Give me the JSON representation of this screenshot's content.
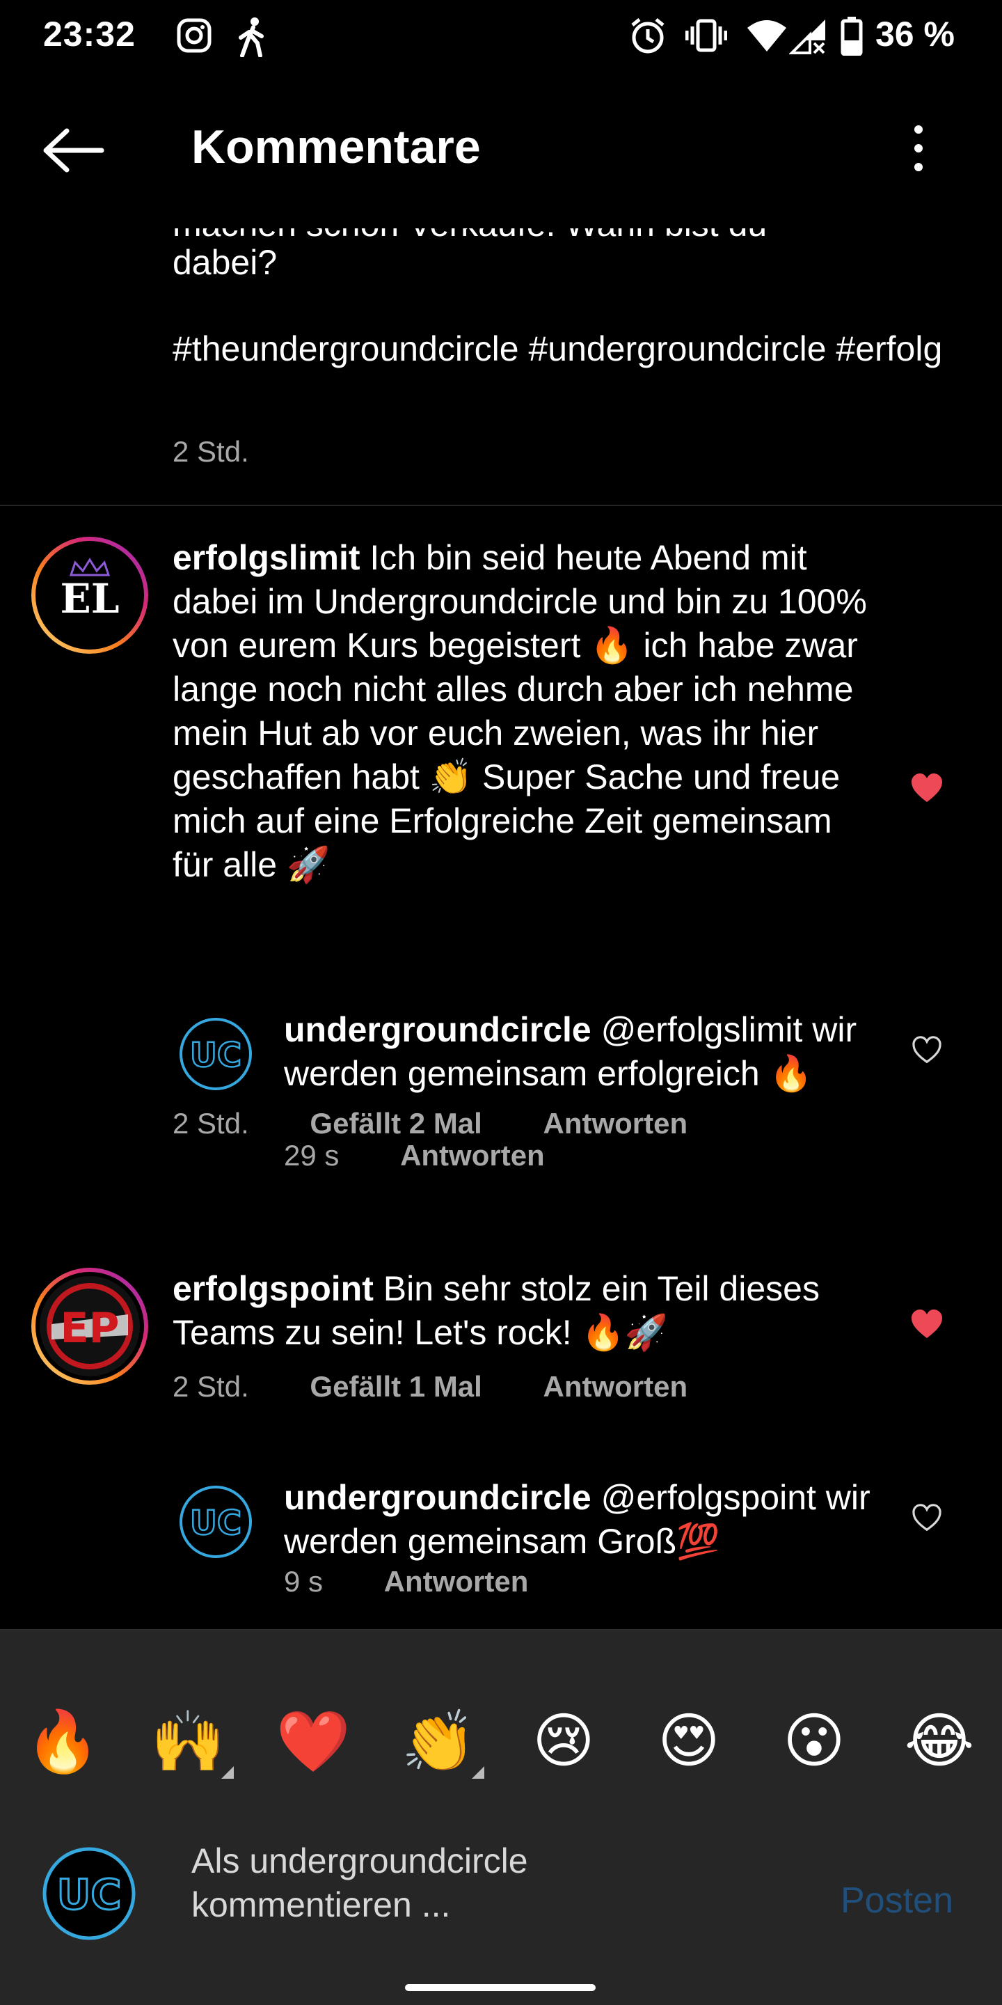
{
  "status_bar": {
    "time": "23:32",
    "battery_text": "36 %"
  },
  "header": {
    "title": "Kommentare"
  },
  "caption": {
    "cut_line": "machen schon Verkäufe. Wann bist du",
    "text": "dabei?",
    "hashtags": "#theundergroundcircle #undergroundcircle #erfolg",
    "time": "2 Std."
  },
  "comments": [
    {
      "username": "erfolgslimit",
      "text": "Ich bin seid heute Abend mit dabei im Undergroundcircle und bin zu 100% von eurem Kurs begeistert 🔥 ich habe zwar lange noch nicht alles durch aber ich nehme mein Hut ab vor euch zweien, was ihr hier geschaffen habt 👏 Super Sache und freue mich auf eine Erfolgreiche Zeit gemeinsam für alle 🚀",
      "time": "2 Std.",
      "likes": "Gefällt 2 Mal",
      "reply_label": "Antworten",
      "avatar_text": "EL",
      "liked": true
    },
    {
      "username": "undergroundcircle",
      "text": "@erfolgslimit wir werden gemeinsam erfolgreich 🔥",
      "time": "29 s",
      "reply_label": "Antworten",
      "avatar_text": "UC",
      "liked": false
    },
    {
      "username": "erfolgspoint",
      "text": "Bin sehr stolz ein Teil dieses Teams zu sein! Let's rock! 🔥🚀",
      "time": "2 Std.",
      "likes": "Gefällt 1 Mal",
      "reply_label": "Antworten",
      "avatar_text": "EP",
      "liked": true
    },
    {
      "username": "undergroundcircle",
      "text": "@erfolgspoint wir werden gemeinsam Groß💯",
      "time": "9 s",
      "reply_label": "Antworten",
      "avatar_text": "UC",
      "liked": false
    }
  ],
  "emoji_bar": [
    "🔥",
    "🙌",
    "❤️",
    "👏",
    "😢",
    "😍",
    "😮",
    "😂"
  ],
  "composer": {
    "placeholder_line1": "Als undergroundcircle",
    "placeholder_line2": "kommentieren ...",
    "post_label": "Posten",
    "avatar_text": "UC"
  },
  "colors": {
    "background": "#000000",
    "heart_red": "#ed4956",
    "uc_blue": "#36a8e0",
    "post_blue": "#1f4f7a"
  }
}
